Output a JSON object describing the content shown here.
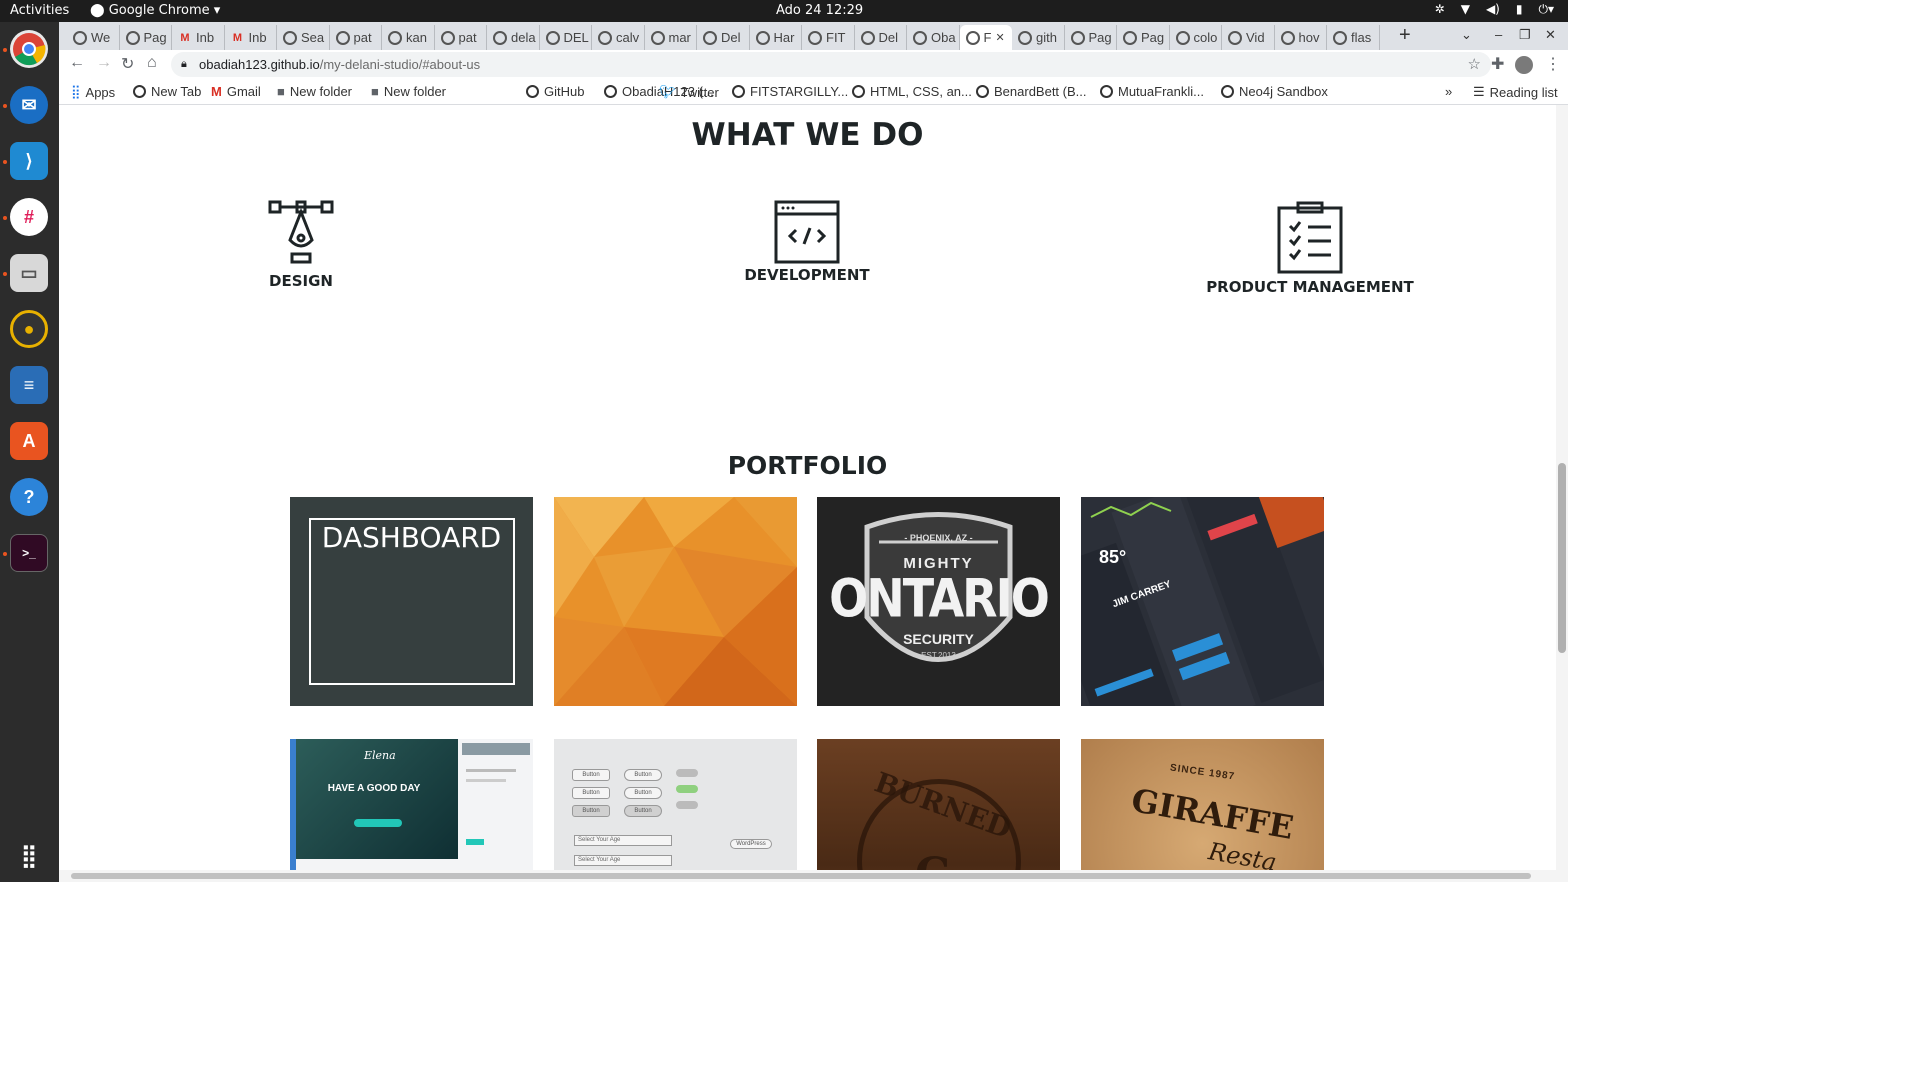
{
  "system": {
    "activities": "Activities",
    "app_name": "Google Chrome",
    "clock": "Ado 24  12:29"
  },
  "dock": [
    "chrome-icon",
    "thunderbird-icon",
    "vscode-icon",
    "slack-icon",
    "files-icon",
    "rhythmbox-icon",
    "writer-icon",
    "software-icon",
    "help-icon",
    "terminal-icon",
    "apps-grid-icon"
  ],
  "tabs": [
    {
      "label": "We"
    },
    {
      "label": "Pag"
    },
    {
      "label": "Inb"
    },
    {
      "label": "Inb"
    },
    {
      "label": "Sea"
    },
    {
      "label": "pat"
    },
    {
      "label": "kan"
    },
    {
      "label": "pat"
    },
    {
      "label": "dela"
    },
    {
      "label": "DEL"
    },
    {
      "label": "calv"
    },
    {
      "label": "mar"
    },
    {
      "label": "Del"
    },
    {
      "label": "Har"
    },
    {
      "label": "FIT"
    },
    {
      "label": "Del"
    },
    {
      "label": "Oba"
    },
    {
      "label": "F"
    },
    {
      "label": "gith"
    },
    {
      "label": "Pag"
    },
    {
      "label": "Pag"
    },
    {
      "label": "colo"
    },
    {
      "label": "Vid"
    },
    {
      "label": "hov"
    },
    {
      "label": "flas"
    }
  ],
  "address": {
    "host": "obadiah123.github.io",
    "path": "/my-delani-studio/#about-us"
  },
  "bookmarks": [
    "Apps",
    "New Tab",
    "Gmail",
    "New folder",
    "New folder",
    "GitHub",
    "ObadiaH123 (...",
    "Twitter",
    "FITSTARGILLY...",
    "HTML, CSS, an...",
    "BenardBett (B...",
    "MutuaFrankli...",
    "Neo4j Sandbox"
  ],
  "reading_list": "Reading list",
  "overflow": "»",
  "page": {
    "what_we_do": "WHAT WE DO",
    "services": [
      {
        "label": "DESIGN",
        "icon": "pen-tool-icon"
      },
      {
        "label": "DEVELOPMENT",
        "icon": "code-window-icon"
      },
      {
        "label": "PRODUCT MANAGEMENT",
        "icon": "clipboard-checklist-icon"
      }
    ],
    "portfolio": "PORTFOLIO",
    "dashboard_label": "DASHBOARD",
    "ontario": {
      "top": "- PHOENIX, AZ -",
      "mid": "MIGHTY",
      "main": "ONTARIO",
      "sub": "SECURITY",
      "est": "EST.2013"
    },
    "weather": {
      "temp": "85°",
      "name": "JIM CARREY"
    },
    "elena": {
      "brand": "Elena",
      "headline": "HAVE A GOOD DAY"
    },
    "ui_kit": {
      "button": "Button",
      "select": "Select Your Age",
      "wordpress": "WordPress"
    },
    "burned": {
      "text": "BURNED",
      "letter": "C"
    },
    "giraffe": {
      "since": "SINCE 1987",
      "name": "GIRAFFE",
      "rest": "Resta"
    }
  }
}
